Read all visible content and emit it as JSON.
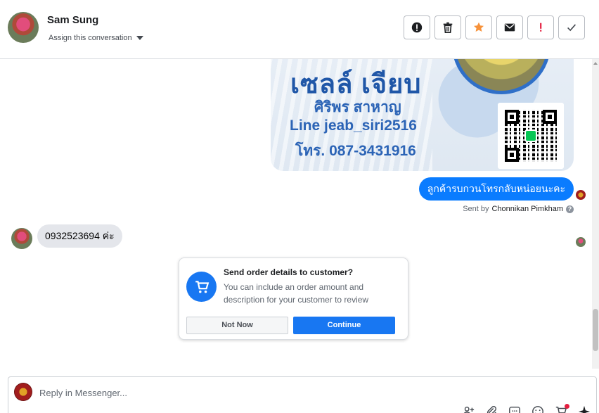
{
  "header": {
    "contact_name": "Sam Sung",
    "assign_label": "Assign this conversation",
    "toolbar": [
      {
        "name": "mark-spam-icon",
        "icon": "exclamation-circle"
      },
      {
        "name": "delete-icon",
        "icon": "trash"
      },
      {
        "name": "star-icon",
        "icon": "star",
        "color": "#f7923a"
      },
      {
        "name": "mark-unread-icon",
        "icon": "envelope"
      },
      {
        "name": "follow-up-icon",
        "icon": "exclamation",
        "color": "#e41e3f"
      },
      {
        "name": "mark-done-icon",
        "icon": "checkmark"
      }
    ]
  },
  "conversation": {
    "card_image": {
      "title": "เซลล์ เจียบ",
      "line1": "ศิริพร สาหาญ",
      "line2": "Line  jeab_siri2516",
      "line3": "โทร. 087-3431916"
    },
    "outgoing_message": "ลูกค้ารบกวนโทรกลับหน่อยนะคะ",
    "sent_by_prefix": "Sent by",
    "sent_by_name": "Chonnikan Pimkham",
    "incoming_message": "0932523694 ค่ะ",
    "order_prompt": {
      "title": "Send order details to customer?",
      "description": "You can include an order amount and description for your customer to review",
      "not_now_label": "Not Now",
      "continue_label": "Continue"
    }
  },
  "reply": {
    "placeholder": "Reply in Messenger..."
  },
  "colors": {
    "accent": "#1877f2",
    "outgoing_bubble": "#0a7cff",
    "incoming_bubble": "#e4e6eb"
  }
}
